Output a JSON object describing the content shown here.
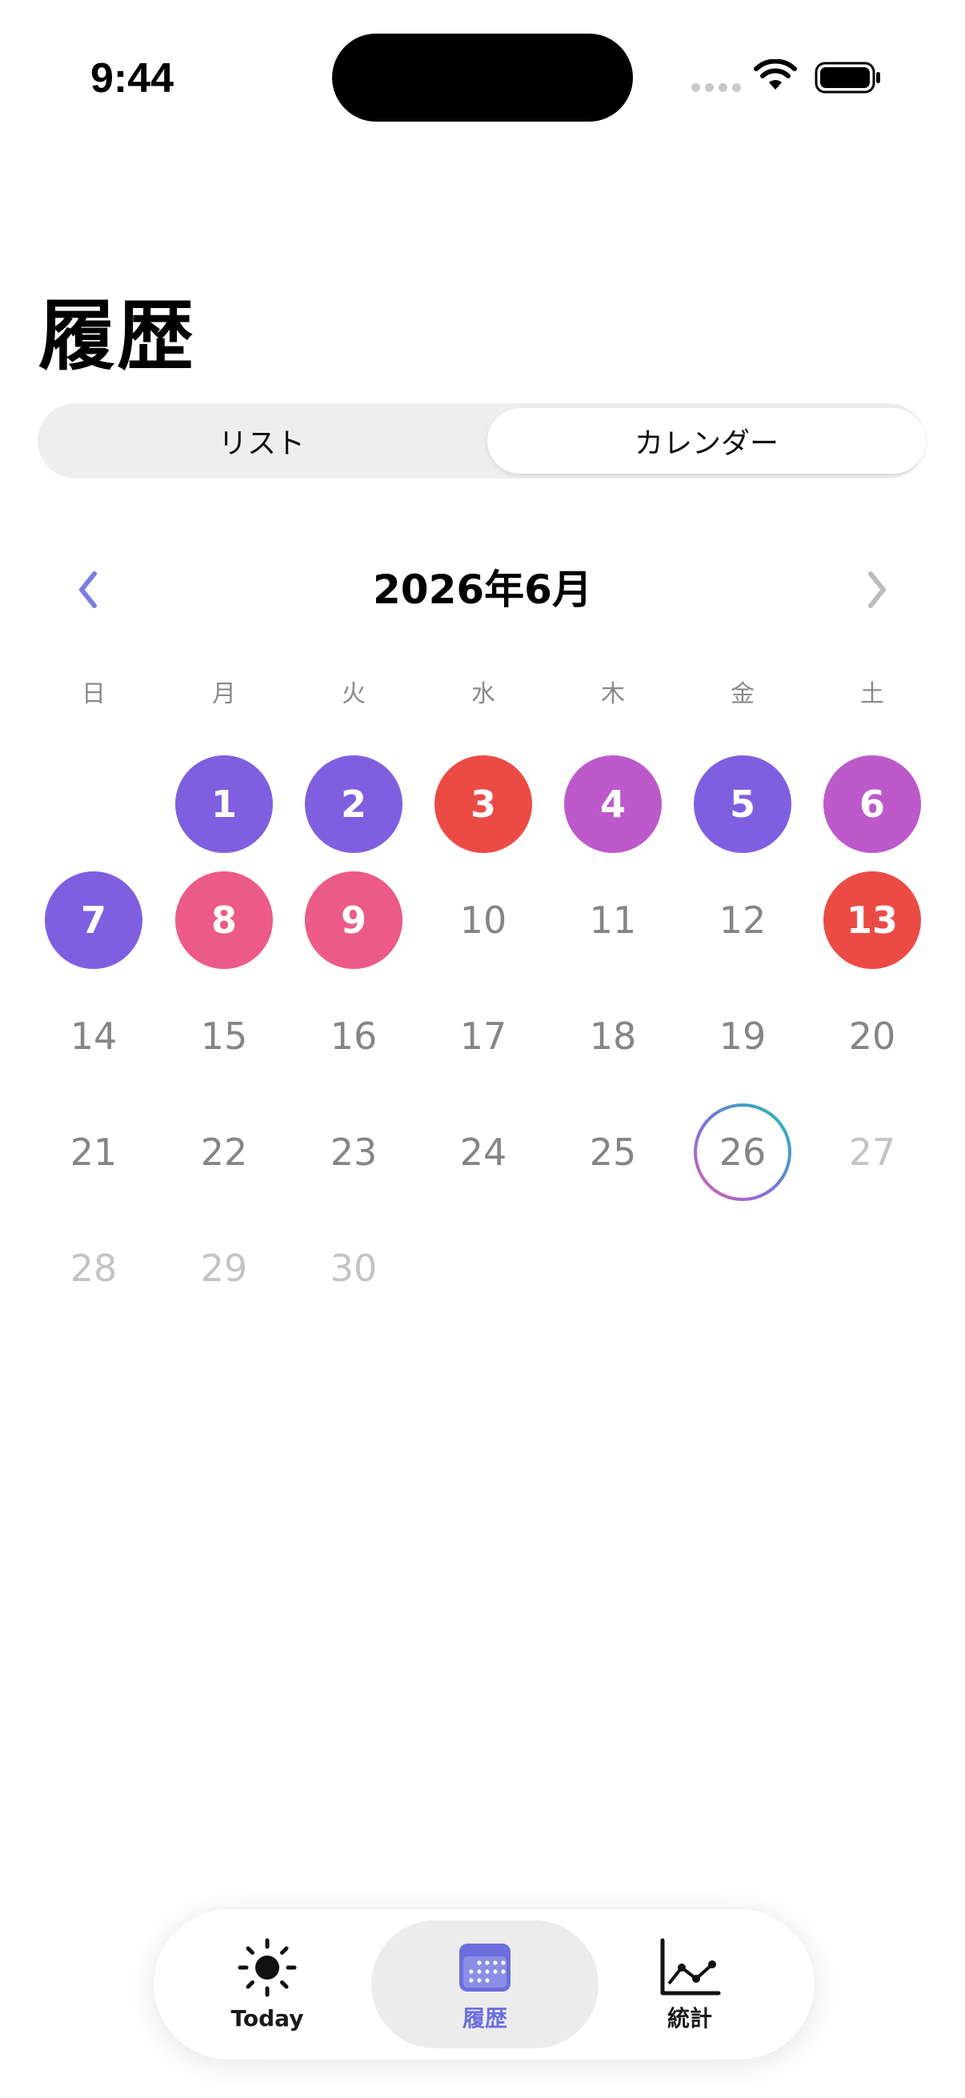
{
  "status_bar": {
    "time": "9:44"
  },
  "header": {
    "title": "履歴"
  },
  "segments": [
    {
      "label": "リスト",
      "selected": false
    },
    {
      "label": "カレンダー",
      "selected": true
    }
  ],
  "calendar": {
    "month_label": "2026年6月",
    "weekdays": [
      "日",
      "月",
      "火",
      "水",
      "木",
      "金",
      "土"
    ],
    "first_weekday_index": 1,
    "days": [
      {
        "day": "1",
        "state": "filled",
        "color": "#7f5fe0"
      },
      {
        "day": "2",
        "state": "filled",
        "color": "#7f5fe0"
      },
      {
        "day": "3",
        "state": "filled",
        "color": "#ec4b45"
      },
      {
        "day": "4",
        "state": "filled",
        "color": "#bd59cb"
      },
      {
        "day": "5",
        "state": "filled",
        "color": "#7f5fe0"
      },
      {
        "day": "6",
        "state": "filled",
        "color": "#bd59cb"
      },
      {
        "day": "7",
        "state": "filled",
        "color": "#7f5fe0"
      },
      {
        "day": "8",
        "state": "filled",
        "color": "#ec5a88"
      },
      {
        "day": "9",
        "state": "filled",
        "color": "#ec5a88"
      },
      {
        "day": "10",
        "state": "past"
      },
      {
        "day": "11",
        "state": "past"
      },
      {
        "day": "12",
        "state": "past"
      },
      {
        "day": "13",
        "state": "filled",
        "color": "#ec4b45"
      },
      {
        "day": "14",
        "state": "past"
      },
      {
        "day": "15",
        "state": "past"
      },
      {
        "day": "16",
        "state": "past"
      },
      {
        "day": "17",
        "state": "past"
      },
      {
        "day": "18",
        "state": "past"
      },
      {
        "day": "19",
        "state": "past"
      },
      {
        "day": "20",
        "state": "past"
      },
      {
        "day": "21",
        "state": "past"
      },
      {
        "day": "22",
        "state": "past"
      },
      {
        "day": "23",
        "state": "past"
      },
      {
        "day": "24",
        "state": "past"
      },
      {
        "day": "25",
        "state": "past"
      },
      {
        "day": "26",
        "state": "today"
      },
      {
        "day": "27",
        "state": "future"
      },
      {
        "day": "28",
        "state": "future"
      },
      {
        "day": "29",
        "state": "future"
      },
      {
        "day": "30",
        "state": "future"
      }
    ]
  },
  "tabbar": {
    "items": [
      {
        "label": "Today",
        "icon": "sun-icon",
        "selected": false
      },
      {
        "label": "履歴",
        "icon": "calendar-icon",
        "selected": true
      },
      {
        "label": "統計",
        "icon": "chart-line-icon",
        "selected": false
      }
    ]
  },
  "colors": {
    "accent": "#6b6fde",
    "nav_prev": "#7b7fe0",
    "nav_next": "#bdbdbd"
  }
}
